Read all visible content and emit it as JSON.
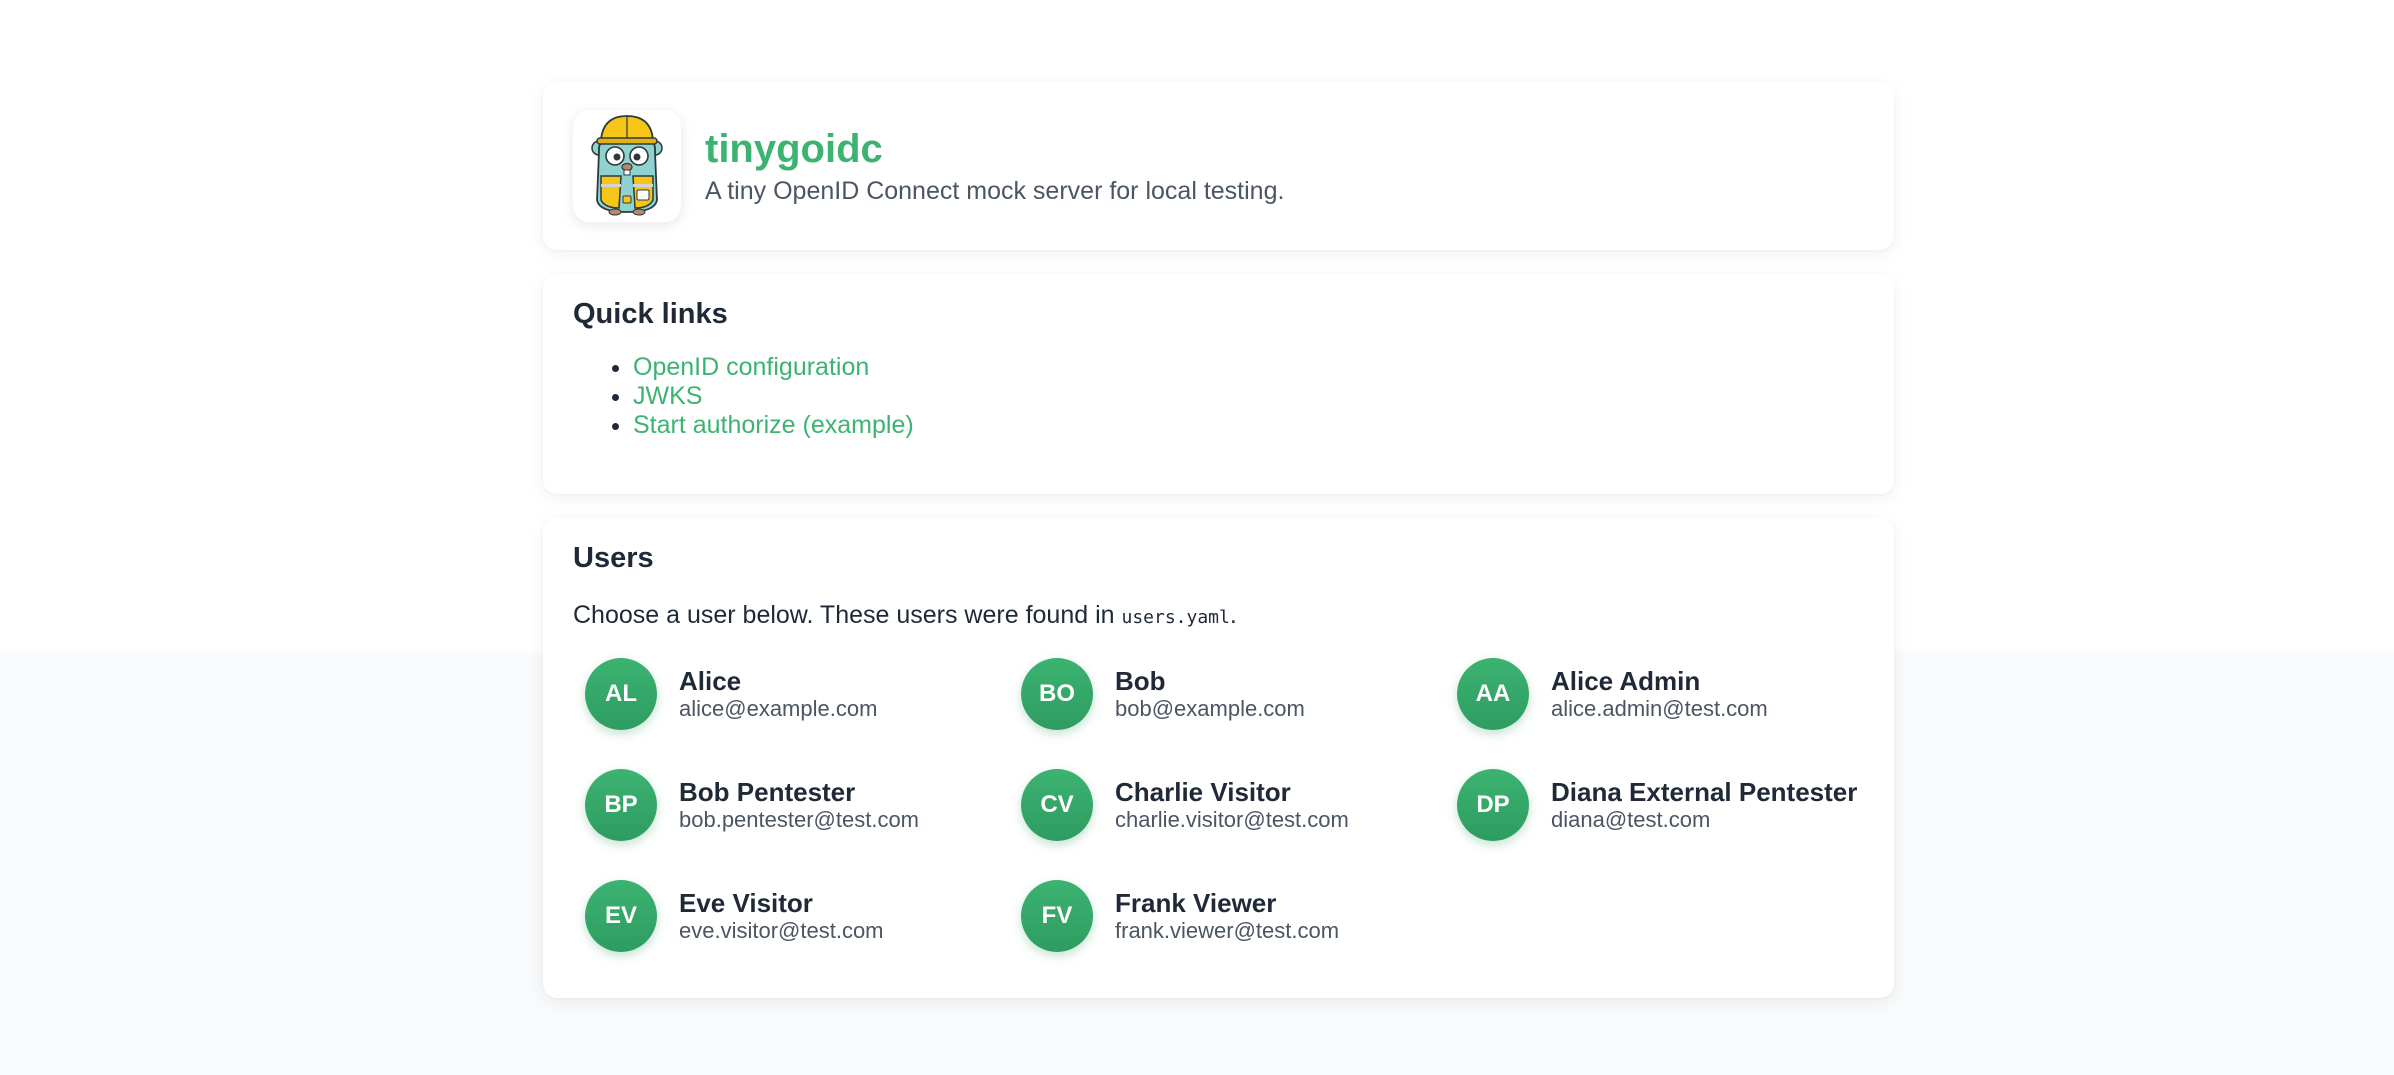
{
  "header": {
    "title": "tinygoidc",
    "subtitle": "A tiny OpenID Connect mock server for local testing.",
    "logo_icon": "gopher-mascot-icon"
  },
  "quick_links": {
    "title": "Quick links",
    "items": [
      {
        "label": "OpenID configuration"
      },
      {
        "label": "JWKS"
      },
      {
        "label": "Start authorize (example)"
      }
    ]
  },
  "users": {
    "title": "Users",
    "description_prefix": "Choose a user below. These users were found in ",
    "description_file": "users.yaml",
    "description_suffix": ".",
    "list": [
      {
        "initials": "AL",
        "name": "Alice",
        "email": "alice@example.com"
      },
      {
        "initials": "BO",
        "name": "Bob",
        "email": "bob@example.com"
      },
      {
        "initials": "AA",
        "name": "Alice Admin",
        "email": "alice.admin@test.com"
      },
      {
        "initials": "BP",
        "name": "Bob Pentester",
        "email": "bob.pentester@test.com"
      },
      {
        "initials": "CV",
        "name": "Charlie Visitor",
        "email": "charlie.visitor@test.com"
      },
      {
        "initials": "DP",
        "name": "Diana External Pentester",
        "email": "diana@test.com"
      },
      {
        "initials": "EV",
        "name": "Eve Visitor",
        "email": "eve.visitor@test.com"
      },
      {
        "initials": "FV",
        "name": "Frank Viewer",
        "email": "frank.viewer@test.com"
      }
    ]
  },
  "colors": {
    "accent": "#3cb371",
    "avatar_dark": "#2e9c61",
    "text": "#1f2937",
    "muted": "#4b5563"
  }
}
